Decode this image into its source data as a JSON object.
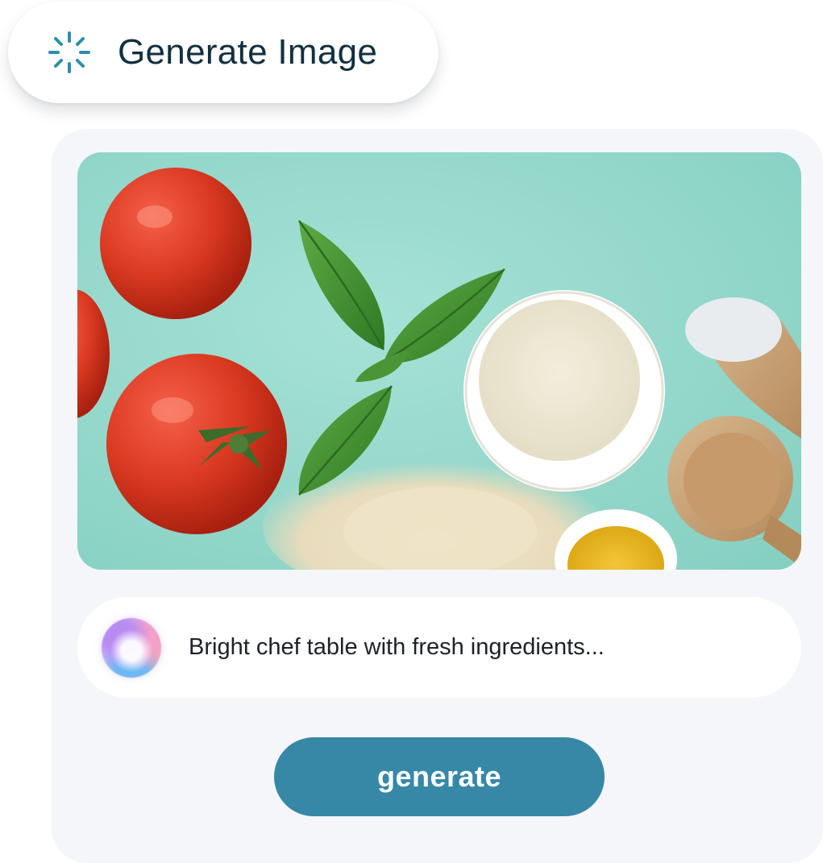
{
  "header": {
    "icon": "spinner-icon",
    "title": "Generate Image"
  },
  "image": {
    "subject": "food-photo-icon"
  },
  "prompt": {
    "icon": "ai-orb-icon",
    "text": "Bright chef table with fresh ingredients..."
  },
  "actions": {
    "generate_label": "generate"
  },
  "colors": {
    "title_text": "#12303f",
    "spinner": "#2a8fa8",
    "card_background": "#f4f6fa",
    "button_background": "#3688a6",
    "button_text": "#ffffff",
    "photo_background": "#98dbcf"
  }
}
